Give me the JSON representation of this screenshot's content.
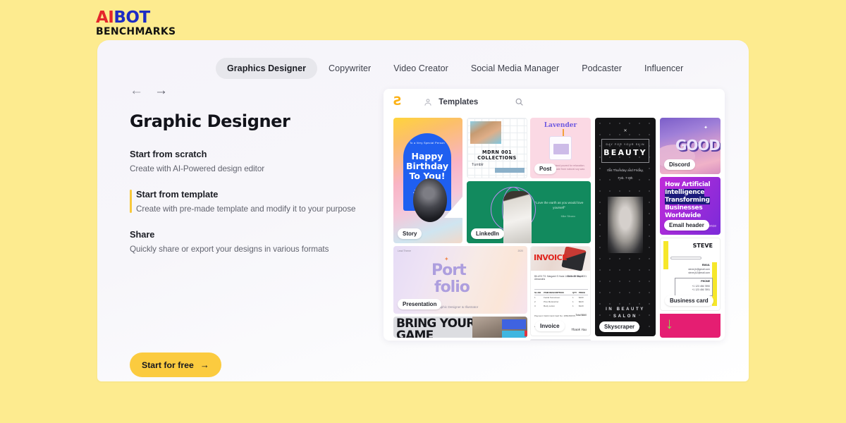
{
  "brand": {
    "part1": "AI",
    "part2": "BOT",
    "part3": "BENCHMARKS"
  },
  "tabs": [
    {
      "label": "Graphics Designer",
      "active": true
    },
    {
      "label": "Copywriter",
      "active": false
    },
    {
      "label": "Video Creator",
      "active": false
    },
    {
      "label": "Social Media Manager",
      "active": false
    },
    {
      "label": "Podcaster",
      "active": false
    },
    {
      "label": "Influencer",
      "active": false
    }
  ],
  "nav": {
    "back": "←",
    "forward": "→"
  },
  "left": {
    "title": "Graphic Designer",
    "features": [
      {
        "title": "Start from scratch",
        "desc": "Create with AI-Powered design editor",
        "active": false
      },
      {
        "title": "Start from template",
        "desc": "Create with pre-made template and modify it to your purpose",
        "active": true
      },
      {
        "title": "Share",
        "desc": "Quickly share or export your designs in various formats",
        "active": false
      }
    ],
    "cta": {
      "label": "Start for free",
      "arrow": "→"
    }
  },
  "app": {
    "logo_icon": "bolt-icon",
    "logo_glyph": "Ƨ",
    "person_icon": "person-icon",
    "templates_label": "Templates",
    "search_icon": "search-icon",
    "tiles": {
      "story": {
        "badge": "Story",
        "top": "To a Very Special Person",
        "line1": "Happy",
        "line2": "Birthday",
        "line3": "To You!",
        "name": "Jono Marjoni"
      },
      "tumblr": {
        "badge": "Tumblr",
        "line1": "MDRN 001",
        "line2": "COLLECTIONS",
        "line3": "Tumblr"
      },
      "post": {
        "badge": "Post",
        "title": "Lavender",
        "sub": "Hand poured for relaxation. Made from natural soy wax."
      },
      "skyscraper": {
        "badge": "Skyscraper",
        "mark": "✕",
        "kicker": "DAY FOR YOUR SKIN",
        "headline": "BEAUTY",
        "date1": "this Thursday and Friday,",
        "date2": "Feb. 7-8th",
        "footer1": "IN BEAUTY",
        "footer2": "SALON"
      },
      "discord": {
        "badge": "Discord",
        "text": "GOOD",
        "star": "✦"
      },
      "email": {
        "badge": "Email header",
        "line1": "How Artificial",
        "line2": "Intelligence",
        "line3": "Transforming",
        "line4": "Businesses",
        "line5": "Worldwide",
        "tail": "ence"
      },
      "linkedin": {
        "badge": "LinkedIn",
        "quote": "\"Love the earth as you would love yourself\"",
        "attrib": "Mike Silvano"
      },
      "presentation": {
        "badge": "Presentation",
        "top_left": "Lead Theme",
        "top_right": "2020",
        "word1": "Port",
        "word2": "folio",
        "sub": "Graphic Designer & Illustrator",
        "spark": "✦"
      },
      "invoice": {
        "badge": "Invoice",
        "word": "INVOICE",
        "billed_to": "BILLED TO:\nMargaret S Huda\n1456 Smith Street\nAlexandria",
        "date": "Date: 23 May 2021",
        "columns": [
          "SL.NO",
          "ITEM DESCRIPTION",
          "QTY",
          "PRICE"
        ],
        "rows": [
          [
            "1",
            "Facial Sunscreen",
            "1",
            "$100"
          ],
          [
            "2",
            "Plus Moisturizer",
            "1",
            "$220"
          ],
          [
            "3",
            "Body Lotion",
            "1",
            "$120"
          ]
        ],
        "subtotal_label": "Subtotal",
        "subtotal": "$744",
        "discount_label": "Discount",
        "discount": "$84",
        "total_label": "Total",
        "total": "$660",
        "payment": "Payment: Debit Card\nCard No: 1884452570",
        "phone": "+123 456 789",
        "thanks": "Thank You"
      },
      "business_card": {
        "badge": "Business card",
        "name": "STEVE",
        "email_label": "EMAIL",
        "email1": "steve.jh@gmail.com",
        "email2": "steve.jh2@mail.com",
        "phone_label": "PHONE",
        "phone1": "+1 123 456 7890",
        "phone2": "+1 123 456 7891"
      },
      "pink": {
        "arrow": "↓"
      },
      "game": {
        "line1": "BRING YOUR",
        "line2": "GAME"
      }
    }
  },
  "colors": {
    "page_bg": "#fdeb8f",
    "accent_yellow": "#fbcb3f",
    "brand_red": "#e4262c",
    "brand_blue": "#1d2cc4",
    "text_dark": "#12131a",
    "text_muted": "#62646f"
  }
}
